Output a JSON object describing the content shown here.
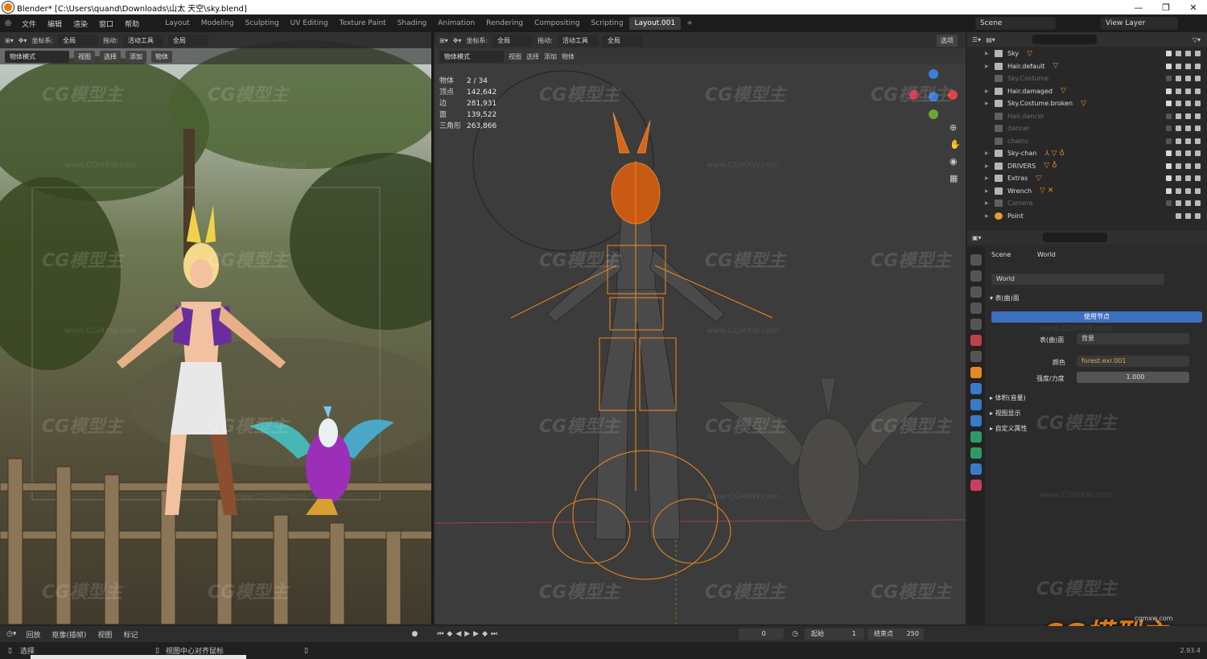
{
  "window": {
    "title": "Blender* [C:\\Users\\quand\\Downloads\\山太 天空\\sky.blend]"
  },
  "topbar": {
    "menu": [
      "文件",
      "编辑",
      "渲染",
      "窗口",
      "帮助"
    ],
    "workspaces": [
      "Layout",
      "Modeling",
      "Sculpting",
      "UV Editing",
      "Texture Paint",
      "Shading",
      "Animation",
      "Rendering",
      "Compositing",
      "Scripting",
      "Layout.001"
    ],
    "active_workspace": "Layout.001",
    "scene": "Scene",
    "view_layer": "View Layer"
  },
  "left_viewport": {
    "header": {
      "coord_label": "坐标系:",
      "coord_value": "全局",
      "drag_label": "拖动:",
      "drag_value": "活动工具",
      "pivot": "全局"
    },
    "subheader": {
      "mode": "物体模式",
      "menus": [
        "视图",
        "选择",
        "添加",
        "物体"
      ]
    }
  },
  "right_viewport": {
    "header": {
      "coord_label": "坐标系:",
      "coord_value": "全局",
      "drag_label": "拖动:",
      "drag_value": "活动工具",
      "pivot": "全局",
      "options": "选项"
    },
    "subheader": {
      "mode": "物体模式",
      "menus": [
        "视图",
        "选择",
        "添加",
        "物体"
      ]
    },
    "stats": [
      {
        "k": "物体",
        "v": "2 / 34"
      },
      {
        "k": "顶点",
        "v": "142,642"
      },
      {
        "k": "边",
        "v": "281,931"
      },
      {
        "k": "面",
        "v": "139,522"
      },
      {
        "k": "三角形",
        "v": "263,866"
      }
    ]
  },
  "outliner": {
    "items": [
      {
        "name": "Sky",
        "dim": false,
        "extra": "▽"
      },
      {
        "name": "Hair.default",
        "dim": false,
        "extra": "▽"
      },
      {
        "name": "Sky.Costume",
        "dim": true,
        "extra": ""
      },
      {
        "name": "Hair.damaged",
        "dim": false,
        "extra": "▽"
      },
      {
        "name": "Sky.Costume.broken",
        "dim": false,
        "extra": "▽"
      },
      {
        "name": "Hair.dancer",
        "dim": true,
        "extra": ""
      },
      {
        "name": "dancer",
        "dim": true,
        "extra": ""
      },
      {
        "name": "chains",
        "dim": true,
        "extra": ""
      },
      {
        "name": "Sky-chan",
        "dim": false,
        "extra": "⅄ ▽ ♁"
      },
      {
        "name": "DRIVERS",
        "dim": false,
        "extra": "▽ ♁"
      },
      {
        "name": "Extras",
        "dim": false,
        "extra": "▽"
      },
      {
        "name": "Wrench",
        "dim": false,
        "extra": "▽ ✕"
      },
      {
        "name": "Camera",
        "dim": true,
        "extra": ""
      },
      {
        "name": "Point",
        "dim": false,
        "extra": ""
      }
    ]
  },
  "properties": {
    "scene_label": "Scene",
    "world_label": "World",
    "world_name": "World",
    "surface_section": "表(曲)面",
    "use_nodes": "使用节点",
    "surface_label": "表(曲)面",
    "surface_value": "背景",
    "color_label": "颜色",
    "color_value": "forest.exr.001",
    "strength_label": "强度/力度",
    "strength_value": "1.000",
    "sections": [
      "体积(音量)",
      "视图显示",
      "自定义属性"
    ]
  },
  "timeline": {
    "menus": [
      "回放",
      "抠像(插帧)",
      "视图",
      "标记"
    ],
    "current_frame": "0",
    "start_label": "起始",
    "start_value": "1",
    "end_label": "结束点",
    "end_value": "250"
  },
  "status": {
    "select": "选择",
    "center": "视图中心对齐鼠标",
    "version": "2.93.4"
  },
  "watermark": {
    "text": "CG模型主",
    "url": "www.CGMXW.com",
    "small": "cgmxw.com"
  }
}
